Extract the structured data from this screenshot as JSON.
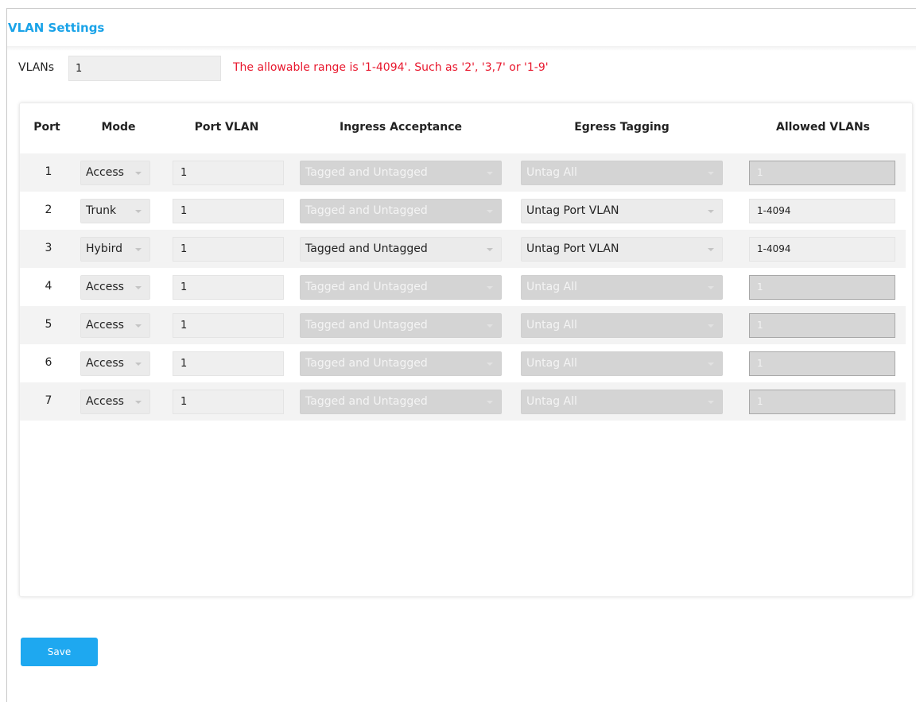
{
  "page": {
    "title": "VLAN Settings"
  },
  "vlans": {
    "label": "VLANs",
    "value": "1",
    "hint": "The allowable range is '1-4094'. Such as '2', '3,7' or '1-9'"
  },
  "table": {
    "headers": {
      "port": "Port",
      "mode": "Mode",
      "port_vlan": "Port VLAN",
      "ingress": "Ingress Acceptance",
      "egress": "Egress Tagging",
      "allowed": "Allowed VLANs"
    },
    "rows": [
      {
        "port": "1",
        "mode": "Access",
        "port_vlan": "1",
        "ingress": "Tagged and Untagged",
        "ingress_disabled": true,
        "egress": "Untag All",
        "egress_disabled": true,
        "allowed": "1",
        "allowed_disabled": true
      },
      {
        "port": "2",
        "mode": "Trunk",
        "port_vlan": "1",
        "ingress": "Tagged and Untagged",
        "ingress_disabled": true,
        "egress": "Untag Port VLAN",
        "egress_disabled": false,
        "allowed": "1-4094",
        "allowed_disabled": false
      },
      {
        "port": "3",
        "mode": "Hybird",
        "port_vlan": "1",
        "ingress": "Tagged and Untagged",
        "ingress_disabled": false,
        "egress": "Untag Port VLAN",
        "egress_disabled": false,
        "allowed": "1-4094",
        "allowed_disabled": false
      },
      {
        "port": "4",
        "mode": "Access",
        "port_vlan": "1",
        "ingress": "Tagged and Untagged",
        "ingress_disabled": true,
        "egress": "Untag All",
        "egress_disabled": true,
        "allowed": "1",
        "allowed_disabled": true
      },
      {
        "port": "5",
        "mode": "Access",
        "port_vlan": "1",
        "ingress": "Tagged and Untagged",
        "ingress_disabled": true,
        "egress": "Untag All",
        "egress_disabled": true,
        "allowed": "1",
        "allowed_disabled": true
      },
      {
        "port": "6",
        "mode": "Access",
        "port_vlan": "1",
        "ingress": "Tagged and Untagged",
        "ingress_disabled": true,
        "egress": "Untag All",
        "egress_disabled": true,
        "allowed": "1",
        "allowed_disabled": true
      },
      {
        "port": "7",
        "mode": "Access",
        "port_vlan": "1",
        "ingress": "Tagged and Untagged",
        "ingress_disabled": true,
        "egress": "Untag All",
        "egress_disabled": true,
        "allowed": "1",
        "allowed_disabled": true
      }
    ]
  },
  "actions": {
    "save_label": "Save"
  },
  "colors": {
    "accent": "#1aa3e8",
    "hint": "#e8182e",
    "button": "#1ea8f0"
  }
}
